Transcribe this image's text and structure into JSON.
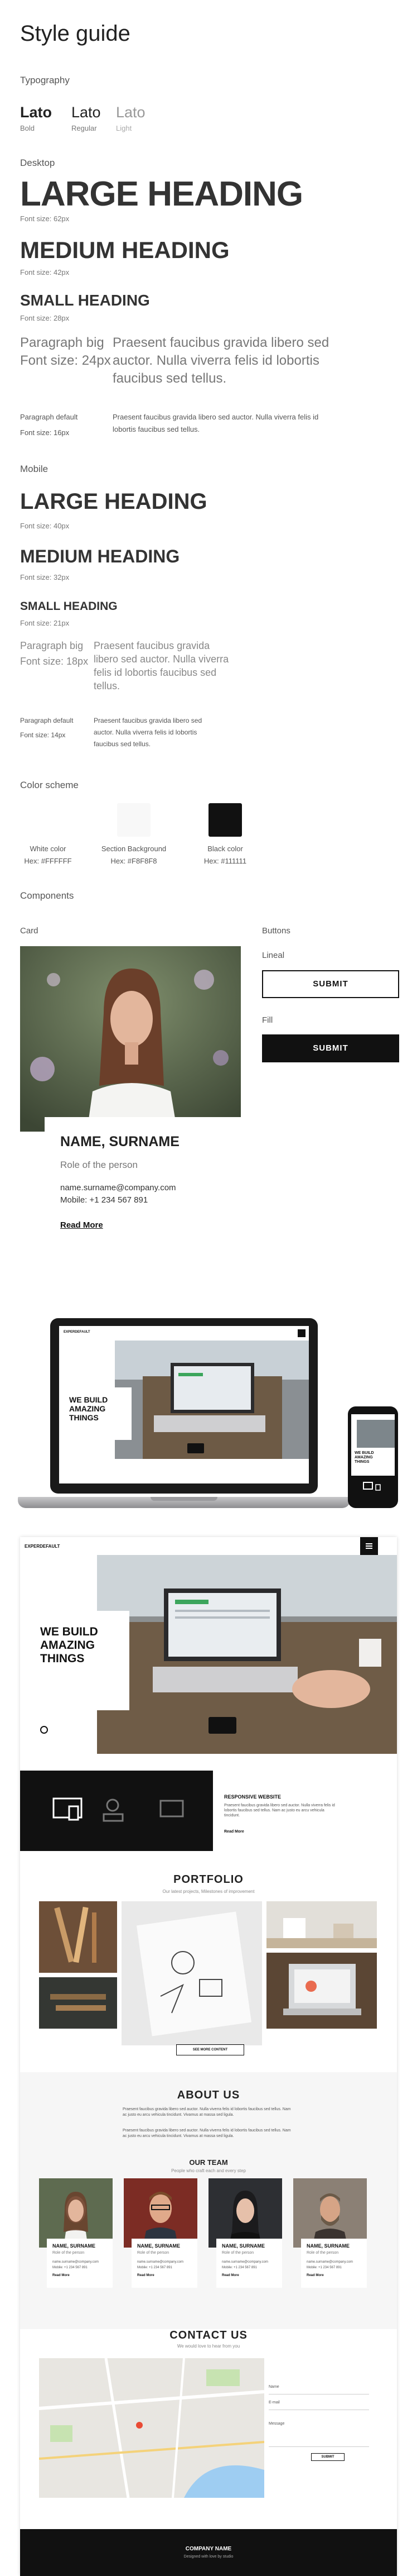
{
  "guide": {
    "title": "Style guide",
    "typography_heading": "Typography",
    "fonts": [
      {
        "name": "Lato",
        "weight": "Bold"
      },
      {
        "name": "Lato",
        "weight": "Regular"
      },
      {
        "name": "Lato",
        "weight": "Light"
      }
    ],
    "desktop_heading": "Desktop",
    "desktop": {
      "large": "LARGE HEADING",
      "large_size": "Font size: 62px",
      "medium": "MEDIUM HEADING",
      "medium_size": "Font size: 42px",
      "small": "SMALL HEADING",
      "small_size": "Font size: 28px",
      "pbig_label": "Paragraph big",
      "pbig_size": "Font size: 24px",
      "pbig_text": "Praesent faucibus gravida libero sed auctor. Nulla viverra felis id lobortis faucibus sed tellus.",
      "pdef_label": "Paragraph default",
      "pdef_size": "Font size: 16px",
      "pdef_text": "Praesent faucibus gravida libero sed auctor. Nulla viverra felis id lobortis faucibus sed tellus."
    },
    "mobile_heading": "Mobile",
    "mobile": {
      "large": "LARGE HEADING",
      "large_size": "Font size: 40px",
      "medium": "MEDIUM HEADING",
      "medium_size": "Font size: 32px",
      "small": "SMALL HEADING",
      "small_size": "Font size: 21px",
      "pbig_label": "Paragraph big",
      "pbig_size": "Font size: 18px",
      "pbig_text": "Praesent faucibus gravida libero sed auctor. Nulla viverra felis id lobortis faucibus sed tellus.",
      "pdef_label": "Paragraph default",
      "pdef_size": "Font size: 14px",
      "pdef_text": "Praesent faucibus gravida libero sed auctor. Nulla viverra felis id lobortis faucibus sed tellus."
    },
    "color_heading": "Color scheme",
    "colors": [
      {
        "name": "White color",
        "hex_label": "Hex: #FFFFFF",
        "hex": "#FFFFFF"
      },
      {
        "name": "Section Background",
        "hex_label": "Hex: #F8F8F8",
        "hex": "#F8F8F8"
      },
      {
        "name": "Black color",
        "hex_label": "Hex: #111111",
        "hex": "#111111"
      }
    ],
    "components_heading": "Components",
    "card_heading": "Card",
    "card": {
      "name": "NAME, SURNAME",
      "role": "Role of the person",
      "email": "name.surname@company.com",
      "mobile": "Mobile: +1 234 567 891",
      "read_more": "Read More"
    },
    "buttons_heading": "Buttons",
    "lineal_label": "Lineal",
    "fill_label": "Fill",
    "submit": "SUBMIT"
  },
  "mockup": {
    "logo": "EXPERDEFAULT",
    "hero": "WE BUILD AMAZING THINGS",
    "responsive_title": "RESPONSIVE WEBSITE",
    "responsive_text": "Praesent faucibus gravida libero sed auctor. Nulla viverra felis id lobortis faucibus sed tellus. Nam ac justo eu arcu vehicula tincidunt.",
    "read_more": "Read More",
    "portfolio_title": "PORTFOLIO",
    "portfolio_sub": "Our latest projects, Milestones of improvement",
    "see_more": "SEE MORE CONTENT",
    "about_title": "ABOUT US",
    "about_text": "Praesent faucibus gravida libero sed auctor. Nulla viverra felis id lobortis faucibus sed tellus. Nam ac justo eu arcu vehicula tincidunt. Vivamus at massa sed ligula.",
    "team_title": "OUR TEAM",
    "team_sub": "People who craft each and every step",
    "team": [
      {
        "name": "NAME, SURNAME",
        "role": "Role of the person"
      },
      {
        "name": "NAME, SURNAME",
        "role": "Role of the person"
      },
      {
        "name": "NAME, SURNAME",
        "role": "Role of the person"
      },
      {
        "name": "NAME, SURNAME",
        "role": "Role of the person"
      }
    ],
    "contact_title": "CONTACT US",
    "contact_sub": "We would love to hear from you",
    "form_name": "Name",
    "form_email": "E-mail",
    "form_message": "Message",
    "form_submit": "SUBMIT",
    "footer_company": "COMPANY NAME",
    "footer_sub": "Designed with love by studio"
  }
}
